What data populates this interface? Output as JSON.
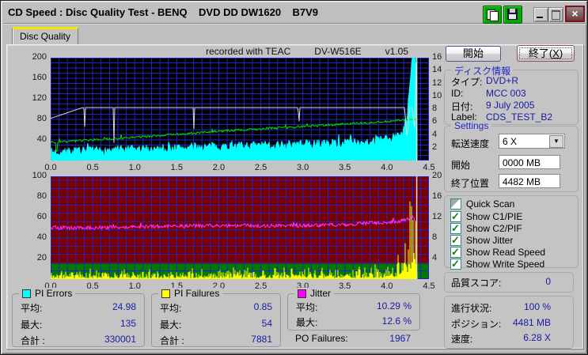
{
  "window": {
    "title": "CD Speed : Disc Quality Test - BENQ    DVD DD DW1620    B7V9",
    "close_glyph": "×"
  },
  "tab": {
    "label": "Disc Quality"
  },
  "chart_header": {
    "recorded": "recorded with TEAC",
    "device": "DV-W516E",
    "version": "v1.05"
  },
  "panel": {
    "start_button": "開始",
    "exit_button_prefix": "終了(",
    "exit_button_key": "X",
    "exit_button_suffix": ")",
    "disc_info": {
      "title": "ディスク情報",
      "rows": [
        {
          "label": "タイプ:",
          "value": "DVD+R"
        },
        {
          "label": "ID:",
          "value": "MCC 003"
        },
        {
          "label": "日付:",
          "value": "9 July 2005"
        },
        {
          "label": "Label:",
          "value": "CDS_TEST_B2"
        }
      ]
    },
    "settings": {
      "title": "Settings",
      "speed_label": "転送速度",
      "speed_value": "6 X",
      "dropdown_glyph": "▼",
      "start_label": "開始",
      "start_value": "0000 MB",
      "end_label": "終了位置",
      "end_value": "4482 MB"
    },
    "checkboxes": [
      {
        "label": "Quick Scan",
        "checked": false
      },
      {
        "label": "Show C1/PIE",
        "checked": true
      },
      {
        "label": "Show C2/PIF",
        "checked": true
      },
      {
        "label": "Show Jitter",
        "checked": true
      },
      {
        "label": "Show Read Speed",
        "checked": true
      },
      {
        "label": "Show Write Speed",
        "checked": true
      }
    ],
    "quality": {
      "label": "品質スコア:",
      "value": "0"
    },
    "progress": {
      "rows": [
        {
          "label": "進行状況:",
          "value": "100 %"
        },
        {
          "label": "ポジション:",
          "value": "4481 MB"
        },
        {
          "label": "速度:",
          "value": "6.28 X"
        }
      ]
    }
  },
  "stats": {
    "boxes": [
      {
        "name": "PI Errors",
        "color": "#00FFFF",
        "rows": [
          {
            "label": "平均:",
            "value": "24.98"
          },
          {
            "label": "最大:",
            "value": "135"
          },
          {
            "label": "合計 :",
            "value": "330001"
          }
        ]
      },
      {
        "name": "PI Failures",
        "color": "#FFFF00",
        "rows": [
          {
            "label": "平均:",
            "value": "0.85"
          },
          {
            "label": "最大:",
            "value": "54"
          },
          {
            "label": "合計 :",
            "value": "7881"
          }
        ]
      },
      {
        "name": "Jitter",
        "color": "#FF00FF",
        "rows": [
          {
            "label": "平均:",
            "value": "10.29 %"
          },
          {
            "label": "最大:",
            "value": "12.6 %"
          }
        ],
        "extra_row": {
          "label": "PO Failures:",
          "value": "1967"
        }
      }
    ]
  },
  "chart_data": [
    {
      "type": "area",
      "title": "PI Errors / Jitter-free speeds (top graph)",
      "bg": "#000000",
      "grid_color": "#2323C4",
      "grid_x_step": 0.1,
      "grid_y_step": 10,
      "x_range": [
        0,
        4.5
      ],
      "x_ticks": [
        "0.0",
        "0.5",
        "1.0",
        "1.5",
        "2.0",
        "2.5",
        "3.0",
        "3.5",
        "4.0",
        "4.5"
      ],
      "left_axis": {
        "max": 200,
        "ticks": [
          200,
          160,
          120,
          80,
          40
        ]
      },
      "right_axis": {
        "max": 16,
        "ticks": [
          16,
          14,
          12,
          10,
          8,
          6,
          4,
          2
        ]
      },
      "cursor_x": 4.355,
      "cursor_color": "#DDDDDD",
      "series": [
        {
          "name": "PI Errors",
          "type": "area",
          "color": "#00FFFF",
          "seed": 7,
          "noise": 9,
          "spike_p": 0.035,
          "spike_add": 22,
          "keyframes": [
            [
              0,
              16
            ],
            [
              0.5,
              18
            ],
            [
              1.0,
              21
            ],
            [
              1.5,
              24
            ],
            [
              2.0,
              27
            ],
            [
              2.5,
              29
            ],
            [
              3.0,
              31
            ],
            [
              3.5,
              34
            ],
            [
              3.9,
              38
            ],
            [
              4.1,
              44
            ],
            [
              4.18,
              55
            ],
            [
              4.24,
              85
            ],
            [
              4.27,
              140
            ],
            [
              4.3,
              200
            ],
            [
              4.34,
              200
            ],
            [
              4.36,
              50
            ]
          ]
        },
        {
          "name": "Write Speed",
          "type": "line",
          "color": "#00DC00",
          "seed": 3,
          "noise": 2.2,
          "spike_p": 0.03,
          "spike_add": 6,
          "keyframes": [
            [
              0,
              36
            ],
            [
              0.055,
              36
            ],
            [
              0.07,
              9
            ],
            [
              0.085,
              36
            ],
            [
              1.0,
              45
            ],
            [
              2.0,
              57
            ],
            [
              3.0,
              66
            ],
            [
              4.0,
              76
            ],
            [
              4.3,
              80
            ],
            [
              4.36,
              80
            ]
          ]
        },
        {
          "name": "Read Speed",
          "type": "line",
          "color": "#D8D8D8",
          "seed": 1,
          "noise": 0,
          "spike_p": 0,
          "spike_add": 0,
          "keyframes": [
            [
              0,
              82
            ],
            [
              0.38,
              103
            ],
            [
              0.395,
              103
            ],
            [
              0.403,
              55
            ],
            [
              0.411,
              103
            ],
            [
              0.745,
              103
            ],
            [
              0.753,
              33
            ],
            [
              0.761,
              103
            ],
            [
              1.695,
              103
            ],
            [
              1.703,
              55
            ],
            [
              1.711,
              103
            ],
            [
              2.945,
              103
            ],
            [
              2.953,
              60
            ],
            [
              2.961,
              103
            ],
            [
              4.21,
              103
            ],
            [
              4.24,
              42
            ],
            [
              4.27,
              103
            ],
            [
              4.3,
              103
            ],
            [
              4.33,
              60
            ],
            [
              4.35,
              195
            ]
          ]
        }
      ]
    },
    {
      "type": "area",
      "title": "PI Failures / Jitter (bottom graph)",
      "bg": "#7A0000",
      "grid_color": "#2323C4",
      "grid_x_step": 0.1,
      "grid_y_step": 8,
      "x_range": [
        0,
        4.5
      ],
      "x_ticks": [
        "0.0",
        "0.5",
        "1.0",
        "1.5",
        "2.0",
        "2.5",
        "3.0",
        "3.5",
        "4.0",
        "4.5"
      ],
      "left_axis": {
        "max": 100,
        "ticks": [
          100,
          80,
          60,
          40,
          20
        ]
      },
      "right_axis": {
        "max": 20,
        "ticks": [
          20,
          16,
          12,
          8,
          4
        ]
      },
      "zones": [
        {
          "from": 0,
          "to": 15,
          "color": "#007A00"
        }
      ],
      "cursor_x": 4.355,
      "cursor_color": "#DDDDDD",
      "series": [
        {
          "name": "PI Failures",
          "type": "bars",
          "color": "#FFFF00",
          "seed": 11,
          "noise": 0,
          "spike_p": 0.02,
          "spike_add": 4,
          "keyframes": [
            [
              0,
              6
            ],
            [
              1.0,
              6
            ],
            [
              1.5,
              7
            ],
            [
              2.5,
              7
            ],
            [
              3.5,
              7
            ],
            [
              4.0,
              9
            ],
            [
              4.1,
              14
            ],
            [
              4.15,
              22
            ],
            [
              4.2,
              30
            ],
            [
              4.25,
              42
            ],
            [
              4.3,
              54
            ],
            [
              4.33,
              50
            ],
            [
              4.36,
              25
            ]
          ]
        },
        {
          "name": "Jitter",
          "type": "line",
          "color": "#FF30FF",
          "seed": 5,
          "noise": 1.8,
          "spike_p": 0.03,
          "spike_add": 3,
          "keyframes": [
            [
              0,
              50
            ],
            [
              0.5,
              50
            ],
            [
              1.0,
              51
            ],
            [
              2.0,
              52
            ],
            [
              3.0,
              52
            ],
            [
              3.5,
              53
            ],
            [
              3.9,
              55
            ],
            [
              4.15,
              56
            ],
            [
              4.25,
              58
            ],
            [
              4.3,
              62
            ],
            [
              4.34,
              56
            ]
          ]
        }
      ]
    }
  ]
}
